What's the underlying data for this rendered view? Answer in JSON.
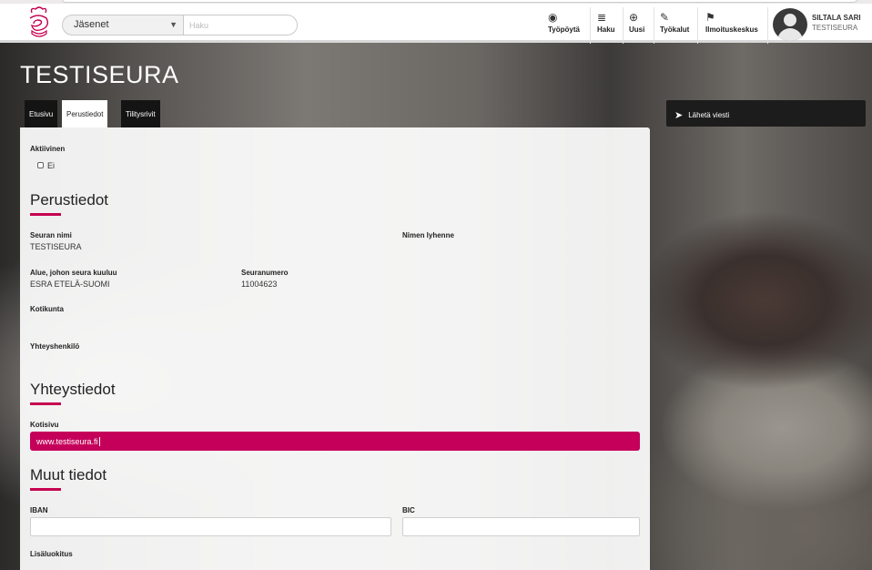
{
  "header": {
    "select_value": "Jäsenet",
    "search_placeholder": "Haku",
    "nav": [
      {
        "label": "Työpöytä",
        "icon": "dashboard-icon"
      },
      {
        "label": "Haku",
        "icon": "database-icon"
      },
      {
        "label": "Uusi",
        "icon": "plus-circle-icon"
      },
      {
        "label": "Työkalut",
        "icon": "wrench-icon"
      },
      {
        "label": "Ilmoituskeskus",
        "icon": "flag-icon"
      }
    ],
    "user_name": "SILTALA SARI",
    "user_org": "TESTISEURA"
  },
  "page": {
    "title": "TESTISEURA",
    "tabs": [
      {
        "label": "Etusivu",
        "active": false
      },
      {
        "label": "Perustiedot",
        "active": true
      },
      {
        "label": "Tilitysrivit",
        "active": false
      }
    ],
    "send_button": "Lähetä viesti"
  },
  "form": {
    "active_label": "Aktiivinen",
    "active_value": "Ei",
    "section_basic": "Perustiedot",
    "name_label": "Seuran nimi",
    "name_value": "TESTISEURA",
    "abbr_label": "Nimen lyhenne",
    "region_label": "Alue, johon seura kuuluu",
    "region_value": "ESRA ETELÄ-SUOMI",
    "number_label": "Seuranumero",
    "number_value": "11004623",
    "municipality_label": "Kotikunta",
    "contact_label": "Yhteyshenkilö",
    "section_contact": "Yhteystiedot",
    "homepage_label": "Kotisivu",
    "homepage_value": "www.testiseura.fi",
    "section_other": "Muut tiedot",
    "iban_label": "IBAN",
    "bic_label": "BIC",
    "extra_label": "Lisäluokitus"
  },
  "colors": {
    "accent": "#c6004f",
    "tab_bg": "#141414"
  }
}
